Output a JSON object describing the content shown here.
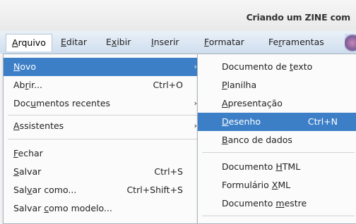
{
  "window": {
    "title": "Criando um ZINE com"
  },
  "menubar": [
    {
      "pre": "",
      "ul": "A",
      "post": "rquivo"
    },
    {
      "pre": "",
      "ul": "E",
      "post": "ditar"
    },
    {
      "pre": "E",
      "ul": "x",
      "post": "ibir"
    },
    {
      "pre": "",
      "ul": "I",
      "post": "nserir"
    },
    {
      "pre": "",
      "ul": "F",
      "post": "ormatar"
    },
    {
      "pre": "Fe",
      "ul": "r",
      "post": "ramentas"
    }
  ],
  "file_menu": {
    "items": [
      {
        "pre": "",
        "ul": "N",
        "post": "ovo",
        "shortcut": "",
        "arrow": "›"
      },
      {
        "pre": "Ab",
        "ul": "r",
        "post": "ir...",
        "shortcut": "Ctrl+O",
        "arrow": ""
      },
      {
        "pre": "Doc",
        "ul": "u",
        "post": "mentos recentes",
        "shortcut": "",
        "arrow": "›"
      },
      {
        "pre": "",
        "ul": "A",
        "post": "ssistentes",
        "shortcut": "",
        "arrow": "›"
      },
      {
        "pre": "",
        "ul": "F",
        "post": "echar",
        "shortcut": "",
        "arrow": ""
      },
      {
        "pre": "",
        "ul": "S",
        "post": "alvar",
        "shortcut": "Ctrl+S",
        "arrow": ""
      },
      {
        "pre": "Sal",
        "ul": "v",
        "post": "ar como...",
        "shortcut": "Ctrl+Shift+S",
        "arrow": ""
      },
      {
        "pre": "Salvar ",
        "ul": "c",
        "post": "omo modelo...",
        "shortcut": "",
        "arrow": ""
      }
    ]
  },
  "new_submenu": {
    "items": [
      {
        "pre": "Documento de ",
        "ul": "t",
        "post": "exto",
        "shortcut": ""
      },
      {
        "pre": "",
        "ul": "P",
        "post": "lanilha",
        "shortcut": ""
      },
      {
        "pre": "",
        "ul": "A",
        "post": "presentação",
        "shortcut": ""
      },
      {
        "pre": "",
        "ul": "D",
        "post": "esenho",
        "shortcut": "Ctrl+N"
      },
      {
        "pre": "",
        "ul": "B",
        "post": "anco de dados",
        "shortcut": ""
      },
      {
        "pre": "Documento ",
        "ul": "H",
        "post": "TML",
        "shortcut": ""
      },
      {
        "pre": "Formulário ",
        "ul": "X",
        "post": "ML",
        "shortcut": ""
      },
      {
        "pre": "Documento ",
        "ul": "m",
        "post": "estre",
        "shortcut": ""
      }
    ]
  }
}
